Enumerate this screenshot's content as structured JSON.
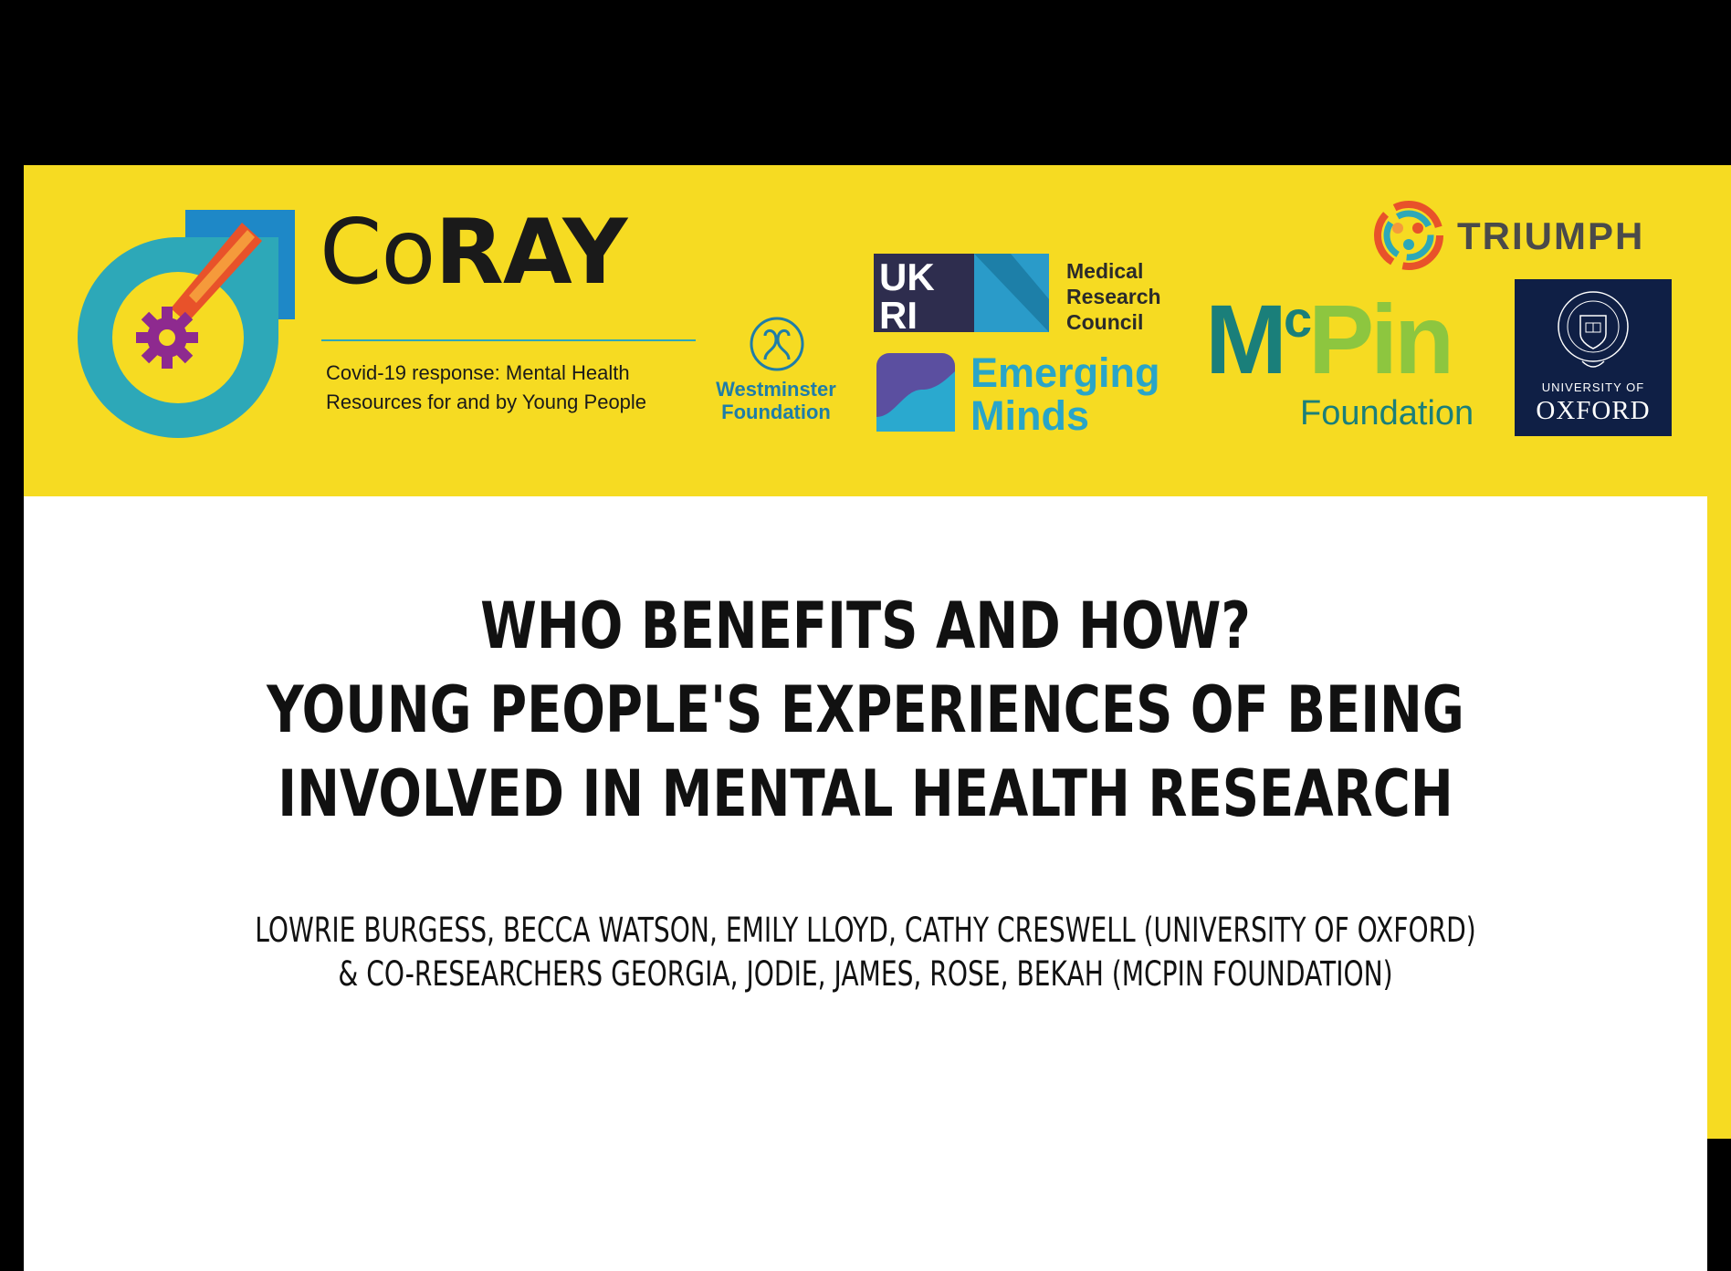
{
  "colors": {
    "banner_yellow": "#F6DB22",
    "background": "#000000",
    "content": "#FFFFFF",
    "coray_teal": "#2DA8B8",
    "mcpin_teal": "#1A7F7A",
    "mcpin_green": "#8DC63F",
    "oxford_blue": "#0F1F45",
    "emerging_blue": "#29A5C8"
  },
  "logos": {
    "coray": {
      "icon": "coray-gear-comet-icon",
      "word_part1": "Co",
      "word_part2": "RAY",
      "tagline_line1": "Covid-19 response: Mental Health",
      "tagline_line2": "Resources for and by Young People"
    },
    "westminster": {
      "icon": "westminster-knot-icon",
      "line1": "Westminster",
      "line2": "Foundation"
    },
    "ukri": {
      "letters": "UKRI",
      "line1": "Medical",
      "line2": "Research",
      "line3": "Council"
    },
    "emerging_minds": {
      "icon": "emerging-minds-icon",
      "line1": "Emerging",
      "line2": "Minds"
    },
    "triumph": {
      "icon": "triumph-people-icon",
      "text": "TRIUMPH"
    },
    "mcpin": {
      "m": "M",
      "c": "c",
      "pin": "Pin",
      "foundation": "Foundation"
    },
    "oxford": {
      "icon": "oxford-crest-icon",
      "line1": "UNIVERSITY OF",
      "line2": "OXFORD"
    }
  },
  "title": {
    "line1": "WHO BENEFITS AND HOW?",
    "line2": "YOUNG PEOPLE'S EXPERIENCES OF BEING",
    "line3": "INVOLVED IN MENTAL HEALTH RESEARCH"
  },
  "authors": {
    "line1": "LOWRIE BURGESS, BECCA WATSON, EMILY LLOYD, CATHY CRESWELL (UNIVERSITY OF OXFORD)",
    "line2": "& CO-RESEARCHERS GEORGIA, JODIE, JAMES, ROSE, BEKAH (MCPIN FOUNDATION)"
  }
}
